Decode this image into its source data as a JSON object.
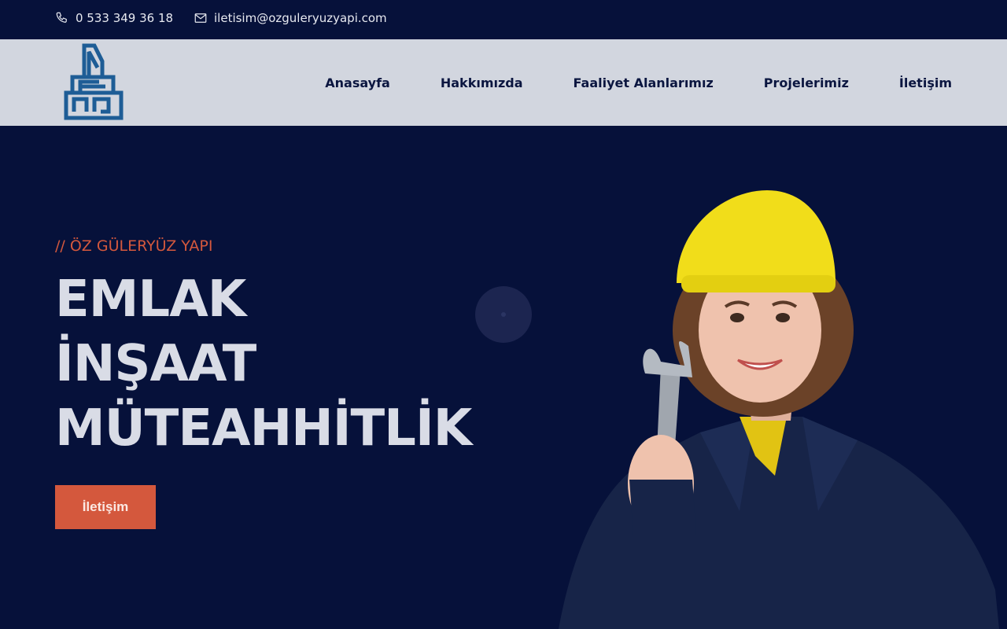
{
  "topbar": {
    "phone": "0 533 349 36 18",
    "email": "iletisim@ozguleryuzyapi.com",
    "phone_icon": "phone-icon",
    "email_icon": "envelope-icon"
  },
  "nav": {
    "logo": "building-logo",
    "items": [
      {
        "label": "Anasayfa"
      },
      {
        "label": "Hakkımızda"
      },
      {
        "label": "Faaliyet Alanlarımız"
      },
      {
        "label": "Projelerimiz"
      },
      {
        "label": "İletişim"
      }
    ]
  },
  "hero": {
    "kicker": "// ÖZ GÜLERYÜZ YAPI",
    "headline": [
      "EMLAK",
      "İNŞAAT",
      "MÜTEAHHİTLİK"
    ],
    "cta_label": "İletişim",
    "image": "construction-worker-photo"
  },
  "colors": {
    "navy": "#06113a",
    "accent": "#d4583d",
    "nav_bg": "#d2d6df",
    "logo_blue": "#1e5d96"
  }
}
